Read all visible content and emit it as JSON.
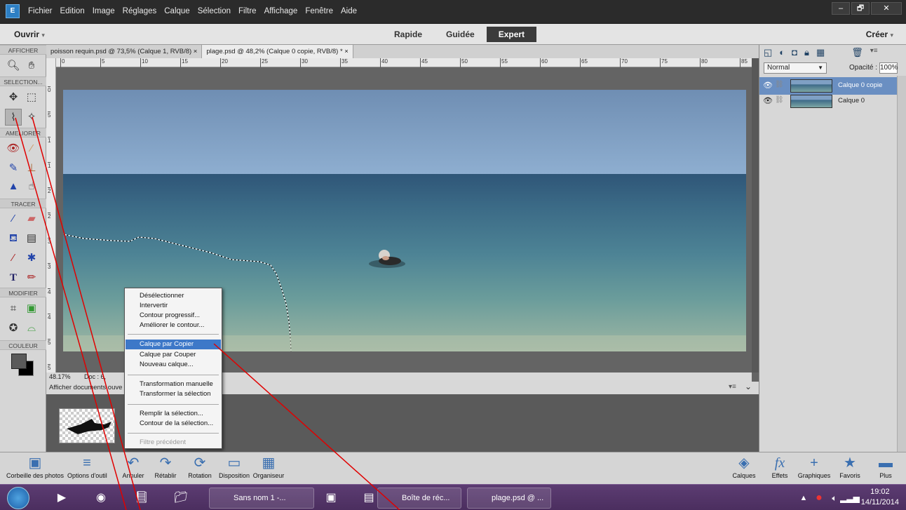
{
  "titlebar": {
    "logo": "E",
    "menu": [
      "Fichier",
      "Edition",
      "Image",
      "Réglages",
      "Calque",
      "Sélection",
      "Filtre",
      "Affichage",
      "Fenêtre",
      "Aide"
    ],
    "win_min": "–",
    "win_max": "🗗",
    "win_close": "✕"
  },
  "modebar": {
    "open": "Ouvrir",
    "open_caret": "▾",
    "tabs": [
      "Rapide",
      "Guidée",
      "Expert"
    ],
    "active_tab": "Expert",
    "create": "Créer",
    "create_caret": "▾"
  },
  "toolbox": {
    "sections": [
      "AFFICHER",
      "SELECTION...",
      "AMELIORER",
      "TRACER",
      "MODIFIER",
      "COULEUR"
    ]
  },
  "doc_tabs": [
    {
      "label": "poisson requin.psd @ 73,5% (Calque 1, RVB/8) ×"
    },
    {
      "label": "plage.psd @ 48,2% (Calque 0 copie, RVB/8) * ×"
    }
  ],
  "rulers": {
    "top": [
      "0",
      "5",
      "10",
      "15",
      "20",
      "25",
      "30",
      "35",
      "40",
      "45",
      "50",
      "55",
      "60",
      "65",
      "70",
      "75",
      "80",
      "85"
    ],
    "left": [
      "0",
      "5",
      "1",
      "1",
      "2",
      "2",
      "3",
      "3",
      "4",
      "4",
      "5",
      "5"
    ]
  },
  "doc_status": {
    "zoom": "48.17%",
    "doc": "Doc : 6,"
  },
  "photobin": {
    "label": "Afficher documents ouve",
    "options": "▾≡",
    "caret": "⌄"
  },
  "layers": {
    "blend_mode": "Normal",
    "opacity_label": "Opacité :",
    "opacity_value": "100%",
    "items": [
      {
        "name": "Calque 0 copie",
        "selected": true
      },
      {
        "name": "Calque 0",
        "selected": false
      }
    ]
  },
  "context_menu": {
    "items": [
      {
        "label": "Désélectionner"
      },
      {
        "label": "Intervertir"
      },
      {
        "label": "Contour progressif..."
      },
      {
        "label": "Améliorer le contour..."
      },
      {
        "label": "Calque par Copier",
        "highlighted": true
      },
      {
        "label": "Calque par Couper"
      },
      {
        "label": "Nouveau calque..."
      },
      {
        "label": "Transformation manuelle"
      },
      {
        "label": "Transformer la sélection"
      },
      {
        "label": "Remplir la sélection..."
      },
      {
        "label": "Contour de la sélection..."
      },
      {
        "label": "Filtre précédent",
        "disabled": true
      }
    ]
  },
  "bottom_bar": {
    "left": [
      {
        "label": "Corbeille des photos",
        "icon": "photo-bin-icon"
      },
      {
        "label": "Options d'outil",
        "icon": "tool-options-icon"
      },
      {
        "label": "Annuler",
        "icon": "undo-icon"
      },
      {
        "label": "Rétablir",
        "icon": "redo-icon"
      },
      {
        "label": "Rotation",
        "icon": "rotate-icon"
      },
      {
        "label": "Disposition",
        "icon": "layout-icon"
      },
      {
        "label": "Organiseur",
        "icon": "organizer-icon"
      }
    ],
    "right": [
      {
        "label": "Calques",
        "icon": "layers-icon"
      },
      {
        "label": "Effets",
        "icon": "effects-icon"
      },
      {
        "label": "Graphiques",
        "icon": "graphics-icon"
      },
      {
        "label": "Favoris",
        "icon": "favorites-icon"
      },
      {
        "label": "Plus",
        "icon": "more-icon"
      }
    ]
  },
  "taskbar": {
    "apps": [
      {
        "label": "Sans nom 1 -..."
      },
      {
        "label": "Boîte de réc..."
      },
      {
        "label": "plage.psd @ ..."
      }
    ],
    "time": "19:02",
    "date": "14/11/2014"
  },
  "colors": {
    "accent": "#3d78c8",
    "annotation_line": "#e00000",
    "selected_layer": "#6a8fc2"
  }
}
